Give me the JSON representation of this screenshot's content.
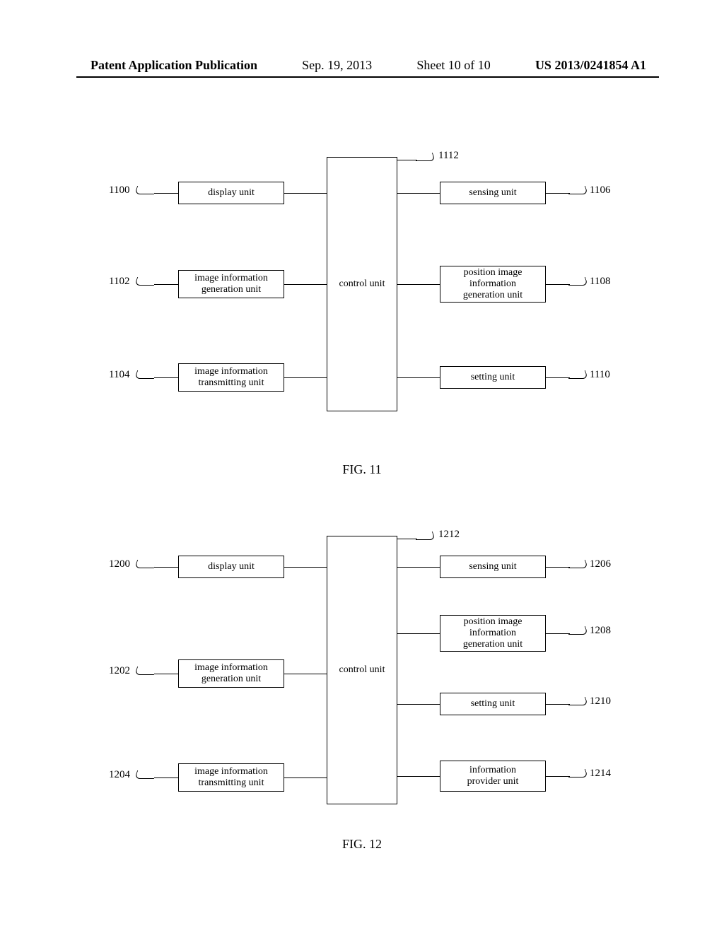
{
  "header": {
    "pubtype": "Patent Application Publication",
    "date": "Sep. 19, 2013",
    "sheet": "Sheet 10 of 10",
    "pubno": "US 2013/0241854 A1"
  },
  "fig11": {
    "caption": "FIG. 11",
    "control_label": "control unit",
    "control_ref": "1112",
    "left": [
      {
        "ref": "1100",
        "label": "display unit"
      },
      {
        "ref": "1102",
        "label": "image information\ngeneration unit"
      },
      {
        "ref": "1104",
        "label": "image information\ntransmitting unit"
      }
    ],
    "right": [
      {
        "ref": "1106",
        "label": "sensing unit"
      },
      {
        "ref": "1108",
        "label": "position image\ninformation\ngeneration unit"
      },
      {
        "ref": "1110",
        "label": "setting unit"
      }
    ]
  },
  "fig12": {
    "caption": "FIG. 12",
    "control_label": "control unit",
    "control_ref": "1212",
    "left": [
      {
        "ref": "1200",
        "label": "display unit"
      },
      {
        "ref": "1202",
        "label": "image information\ngeneration unit"
      },
      {
        "ref": "1204",
        "label": "image information\ntransmitting unit"
      }
    ],
    "right": [
      {
        "ref": "1206",
        "label": "sensing unit"
      },
      {
        "ref": "1208",
        "label": "position image\ninformation\ngeneration unit"
      },
      {
        "ref": "1210",
        "label": "setting unit"
      },
      {
        "ref": "1214",
        "label": "information\nprovider unit"
      }
    ]
  }
}
